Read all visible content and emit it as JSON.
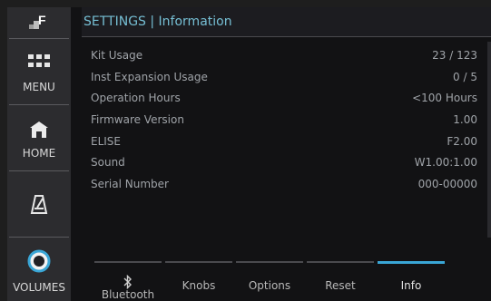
{
  "header": {
    "title": "SETTINGS | Information"
  },
  "sidebar": {
    "logo_icon": "f-logo-icon",
    "menu_label": "MENU",
    "home_label": "HOME",
    "metronome_icon": "metronome-icon",
    "volumes_label": "VOLUMES"
  },
  "info": {
    "rows": [
      {
        "label": "Kit Usage",
        "value": "23 / 123"
      },
      {
        "label": "Inst Expansion Usage",
        "value": "0 / 5"
      },
      {
        "label": "Operation Hours",
        "value": "<100 Hours"
      },
      {
        "label": "Firmware Version",
        "value": "1.00"
      },
      {
        "label": "ELISE",
        "value": "F2.00"
      },
      {
        "label": "Sound",
        "value": "W1.00:1.00"
      },
      {
        "label": "Serial Number",
        "value": "000-00000"
      }
    ]
  },
  "tabs": {
    "active": "Info",
    "items": [
      {
        "label": "Bluetooth",
        "icon": "bluetooth-icon"
      },
      {
        "label": "Knobs"
      },
      {
        "label": "Options"
      },
      {
        "label": "Reset"
      },
      {
        "label": "Info"
      }
    ]
  },
  "colors": {
    "accent": "#3aa6d6",
    "title": "#76bfd4",
    "background": "#121214",
    "sidebar": "#2c2c2f"
  }
}
